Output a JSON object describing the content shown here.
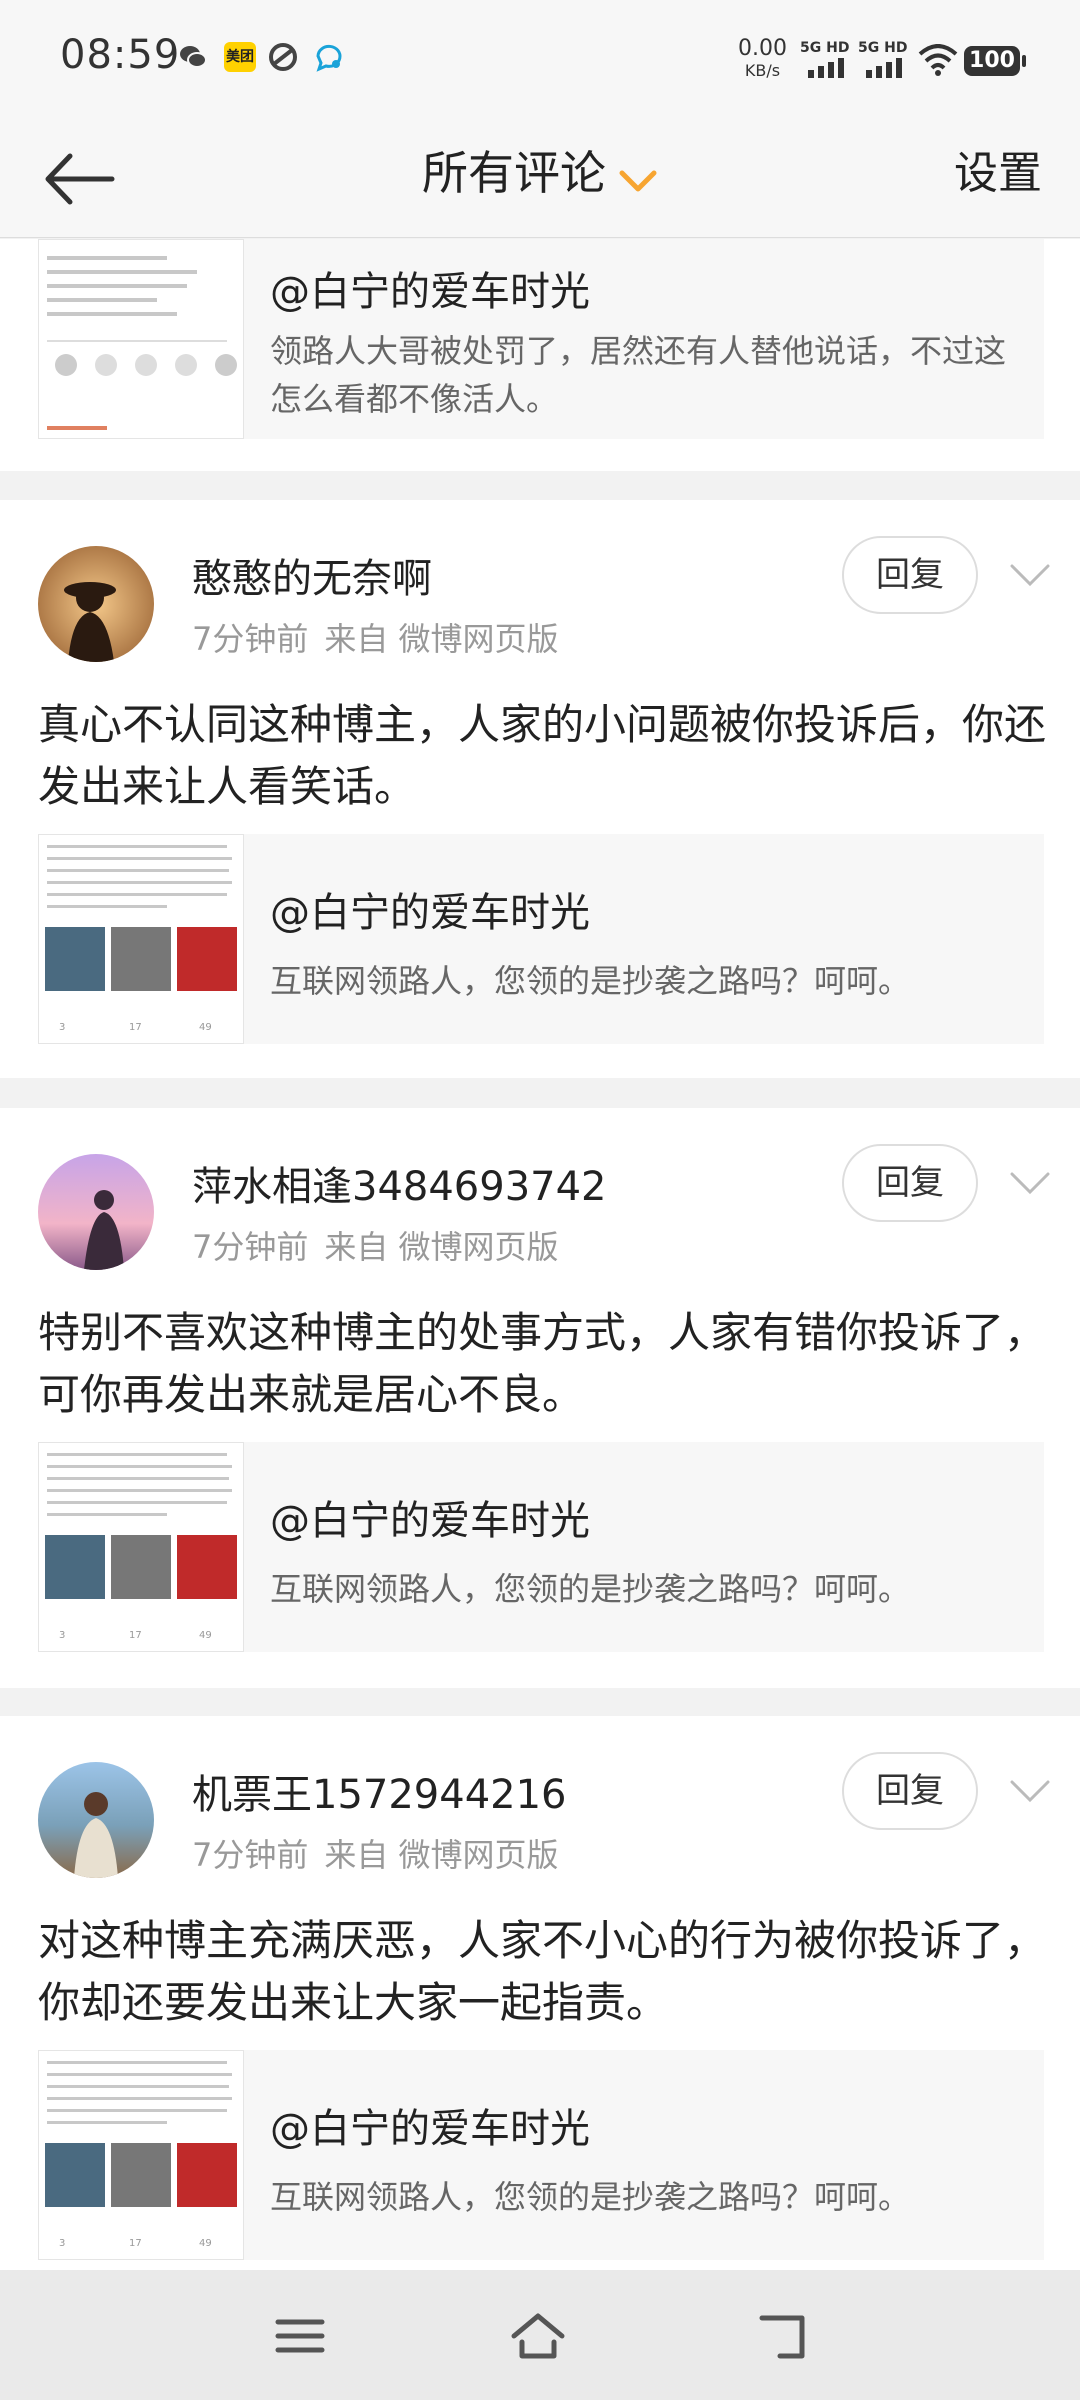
{
  "status_bar": {
    "time": "08:59",
    "app_badge": "美团",
    "net_speed": "0.00",
    "net_unit": "KB/s",
    "sim1": "5G HD",
    "sim2": "5G HD",
    "battery": "100",
    "icons": [
      "wechat-icon",
      "meituan-icon",
      "app-icon",
      "chat-icon",
      "wifi-icon"
    ]
  },
  "header": {
    "back_icon": "back-arrow-icon",
    "title": "所有评论",
    "title_dropdown_icon": "chevron-down-icon",
    "settings_label": "设置"
  },
  "top_quote": {
    "author": "@白宁的爱车时光",
    "text": "领路人大哥被处罚了，居然还有人替他说话，不过这怎么看都不像活人。"
  },
  "comments": [
    {
      "username": "憨憨的无奈啊",
      "time": "7分钟前",
      "source": "来自 微博网页版",
      "reply_label": "回复",
      "text": "真心不认同这种博主，人家的小问题被你投诉后，你还发出来让人看笑话。",
      "quote": {
        "author": "@白宁的爱车时光",
        "text": "互联网领路人，您领的是抄袭之路吗？呵呵。"
      }
    },
    {
      "username": "萍水相逢3484693742",
      "time": "7分钟前",
      "source": "来自 微博网页版",
      "reply_label": "回复",
      "text": "特别不喜欢这种博主的处事方式，人家有错你投诉了，可你再发出来就是居心不良。",
      "quote": {
        "author": "@白宁的爱车时光",
        "text": "互联网领路人，您领的是抄袭之路吗？呵呵。"
      }
    },
    {
      "username": "机票王1572944216",
      "time": "7分钟前",
      "source": "来自 微博网页版",
      "reply_label": "回复",
      "text": "对这种博主充满厌恶，人家不小心的行为被你投诉了，你却还要发出来让大家一起指责。",
      "quote": {
        "author": "@白宁的爱车时光",
        "text": "互联网领路人，您领的是抄袭之路吗？呵呵。"
      }
    }
  ],
  "nav_bar": {
    "icons": [
      "menu-icon",
      "home-icon",
      "back-icon"
    ]
  },
  "colors": {
    "accent": "#f7a531",
    "background": "#f2f2f2",
    "card": "#ffffff",
    "meta_text": "#999999"
  }
}
